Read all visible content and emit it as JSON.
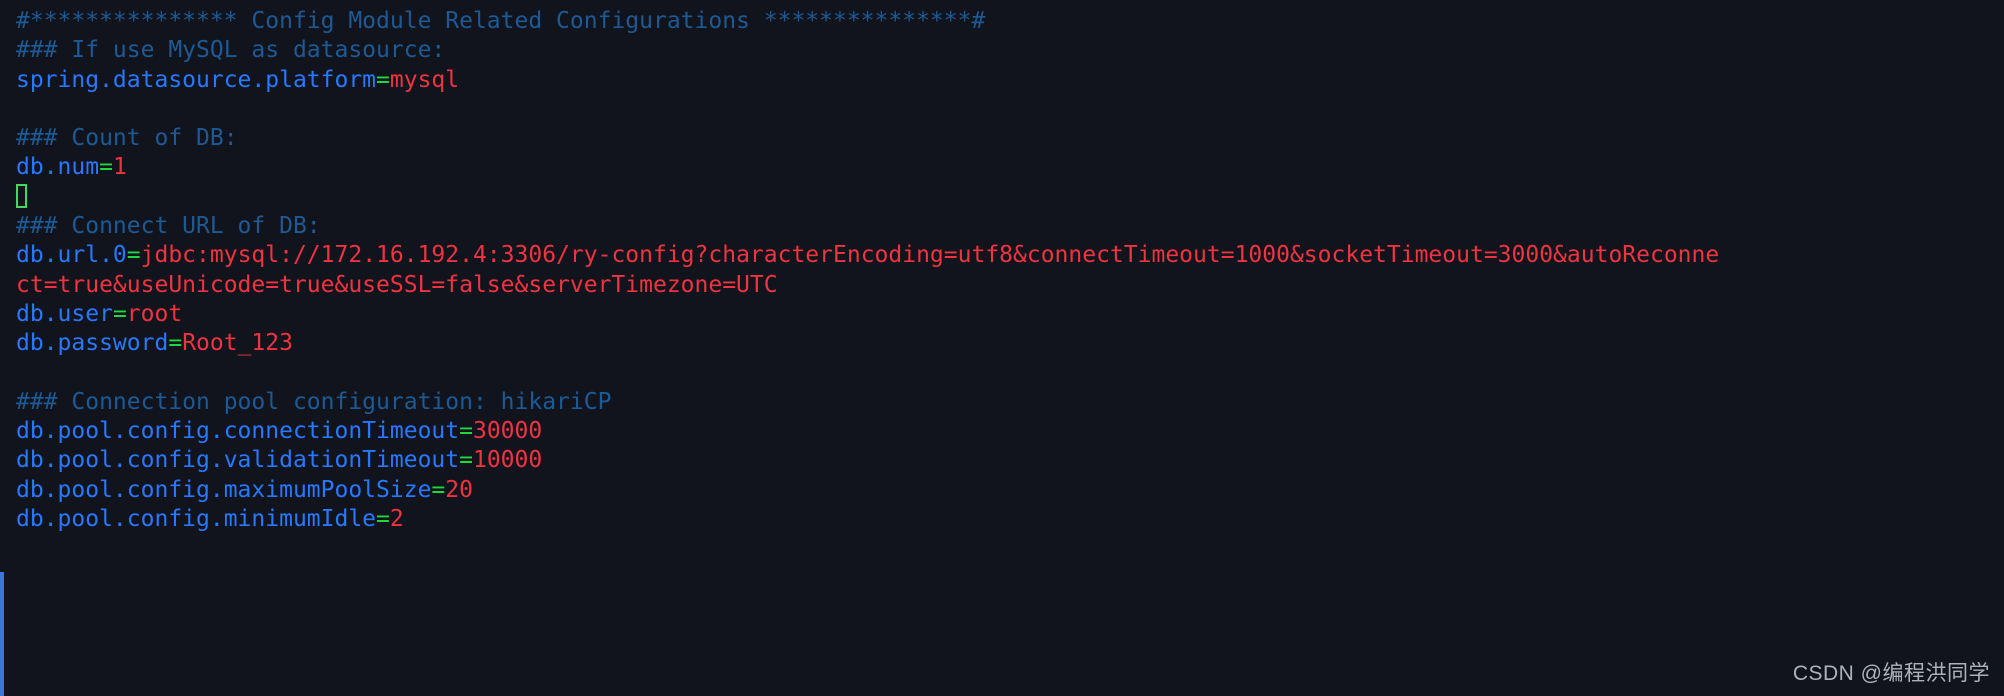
{
  "editor": {
    "background_color": "#11141c",
    "comment_color": "#1d5a95",
    "key_color": "#2878ff",
    "operator_color": "#1fd83b",
    "value_color": "#ef3340",
    "gutter_marker_color": "#3a76d8",
    "cursor_color": "#3ddc5b",
    "file_type": "properties"
  },
  "lines": [
    {
      "type": "comment",
      "text": "#*************** Config Module Related Configurations ***************#"
    },
    {
      "type": "comment",
      "text": "### If use MySQL as datasource:"
    },
    {
      "type": "property",
      "key": "spring.datasource.platform",
      "eq": "=",
      "value": "mysql"
    },
    {
      "type": "blank",
      "text": ""
    },
    {
      "type": "comment",
      "text": "### Count of DB:"
    },
    {
      "type": "property",
      "key": "db.num",
      "eq": "=",
      "value": "1"
    },
    {
      "type": "cursor",
      "text": ""
    },
    {
      "type": "comment",
      "text": "### Connect URL of DB:"
    },
    {
      "type": "property",
      "key": "db.url.0",
      "eq": "=",
      "value": "jdbc:mysql://172.16.192.4:3306/ry-config?characterEncoding=utf8&connectTimeout=1000&socketTimeout=3000&autoReconne"
    },
    {
      "type": "wrap",
      "text": "ct=true&useUnicode=true&useSSL=false&serverTimezone=UTC"
    },
    {
      "type": "property",
      "key": "db.user",
      "eq": "=",
      "value": "root"
    },
    {
      "type": "property",
      "key": "db.password",
      "eq": "=",
      "value": "Root_123"
    },
    {
      "type": "blank",
      "text": ""
    },
    {
      "type": "comment",
      "text": "### Connection pool configuration: hikariCP"
    },
    {
      "type": "property",
      "key": "db.pool.config.connectionTimeout",
      "eq": "=",
      "value": "30000"
    },
    {
      "type": "property",
      "key": "db.pool.config.validationTimeout",
      "eq": "=",
      "value": "10000"
    },
    {
      "type": "property",
      "key": "db.pool.config.maximumPoolSize",
      "eq": "=",
      "value": "20"
    },
    {
      "type": "property",
      "key": "db.pool.config.minimumIdle",
      "eq": "=",
      "value": "2"
    }
  ],
  "watermark": {
    "text": "CSDN @编程洪同学"
  }
}
